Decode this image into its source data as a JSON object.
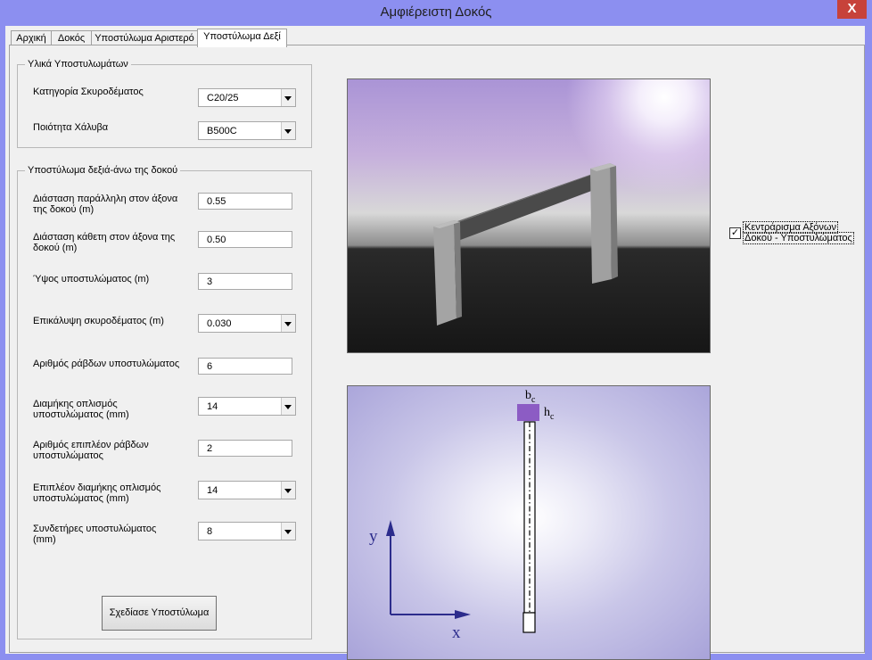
{
  "window": {
    "title": "Αμφιέρειστη Δοκός",
    "close_label": "X"
  },
  "tabs": [
    {
      "label": "Αρχική",
      "active": false
    },
    {
      "label": "Δοκός",
      "active": false
    },
    {
      "label": "Υποστύλωμα Αριστερό",
      "active": false
    },
    {
      "label": "Υποστύλωμα Δεξί",
      "active": true
    }
  ],
  "materials": {
    "legend": "Υλικά Υποστυλωμάτων",
    "concrete": {
      "label": "Κατηγορία Σκυροδέματος",
      "value": "C20/25"
    },
    "steel": {
      "label": "Ποιότητα Χάλυβα",
      "value": "B500C"
    }
  },
  "column": {
    "legend": "Υποστύλωμα δεξιά-άνω της δοκού",
    "dim_parallel": {
      "label1": "Διάσταση παράλληλη στον άξονα",
      "label2": "της δοκού (m)",
      "value": "0.55"
    },
    "dim_perp": {
      "label1": "Διάσταση κάθετη στον άξονα της",
      "label2": "δοκού (m)",
      "value": "0.50"
    },
    "height": {
      "label": "Ύψος υποστυλώματος (m)",
      "value": "3"
    },
    "cover": {
      "label": "Επικάλυψη σκυροδέματος (m)",
      "value": "0.030"
    },
    "bars_count": {
      "label": "Αριθμός ράβδων υποστυλώματος",
      "value": "6"
    },
    "long_reinf": {
      "label1": "Διαμήκης οπλισμός",
      "label2": "υποστυλώματος (mm)",
      "value": "14"
    },
    "extra_bars": {
      "label1": "Αριθμός επιπλέον ράβδων",
      "label2": "υποστυλώματος",
      "value": "2"
    },
    "extra_long": {
      "label1": "Επιπλέον διαμήκης οπλισμός",
      "label2": "υποστυλώματος (mm)",
      "value": "14"
    },
    "stirrups": {
      "label1": "Συνδετήρες υποστυλώματος",
      "label2": "(mm)",
      "value": "8"
    },
    "draw_button": "Σχεδίασε Υποστύλωμα"
  },
  "axis_centering": {
    "label1": "Κεντράρισμα Αξόνων",
    "label2": "Δοκού - Υποστυλώματος",
    "checked": "✓"
  },
  "section": {
    "bc": "b",
    "bc_sub": "c",
    "hc": "h",
    "hc_sub": "c",
    "x_label": "x",
    "y_label": "y",
    "column_color": "#8c5cc4",
    "axis_color": "#2c2c8c"
  }
}
